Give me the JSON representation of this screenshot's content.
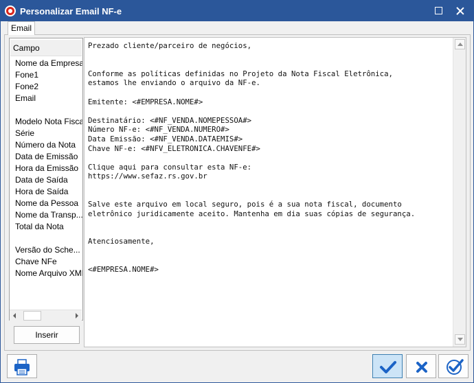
{
  "window": {
    "title": "Personalizar Email NF-e"
  },
  "tabs": [
    {
      "label": "Email"
    }
  ],
  "fields": {
    "header": "Campo",
    "items": [
      "Nome da Empresa",
      "Fone1",
      "Fone2",
      "Email",
      "",
      "Modelo Nota Fiscal",
      "Série",
      "Número da Nota",
      "Data de Emissão",
      "Hora da Emissão",
      "Data de Saída",
      "Hora de Saída",
      "Nome da Pessoa",
      "Nome da Transp...",
      "Total da Nota",
      "",
      "Versão do Sche...",
      "Chave NFe",
      "Nome Arquivo XML"
    ],
    "insert_button": "Inserir"
  },
  "editor": {
    "lines": [
      "Prezado cliente/parceiro de negócios,",
      "",
      "",
      "Conforme as políticas definidas no Projeto da Nota Fiscal Eletrônica,",
      "estamos lhe enviando o arquivo da NF-e.",
      "",
      "Emitente: <#EMPRESA.NOME#>",
      "",
      "Destinatário: <#NF_VENDA.NOMEPESSOA#>",
      "Número NF-e: <#NF_VENDA.NUMERO#>",
      "Data Emissão: <#NF_VENDA.DATAEMIS#>",
      "Chave NF-e: <#NFV_ELETRONICA.CHAVENFE#>",
      "",
      "Clique aqui para consultar esta NF-e:",
      "https://www.sefaz.rs.gov.br",
      "",
      "",
      "Salve este arquivo em local seguro, pois é a sua nota fiscal, documento",
      "eletrônico juridicamente aceito. Mantenha em dia suas cópias de segurança.",
      "",
      "",
      "Atenciosamente,",
      "",
      "",
      "<#EMPRESA.NOME#>"
    ]
  },
  "icons": {
    "app": "nfe-app-icon",
    "print": "printer-icon",
    "confirm": "checkmark-icon",
    "cancel": "x-icon",
    "confirm_all": "check-circle-icon"
  },
  "colors": {
    "titlebar": "#2b579a",
    "accent": "#1b63c6",
    "confirm_highlight": "#cce4f7"
  }
}
